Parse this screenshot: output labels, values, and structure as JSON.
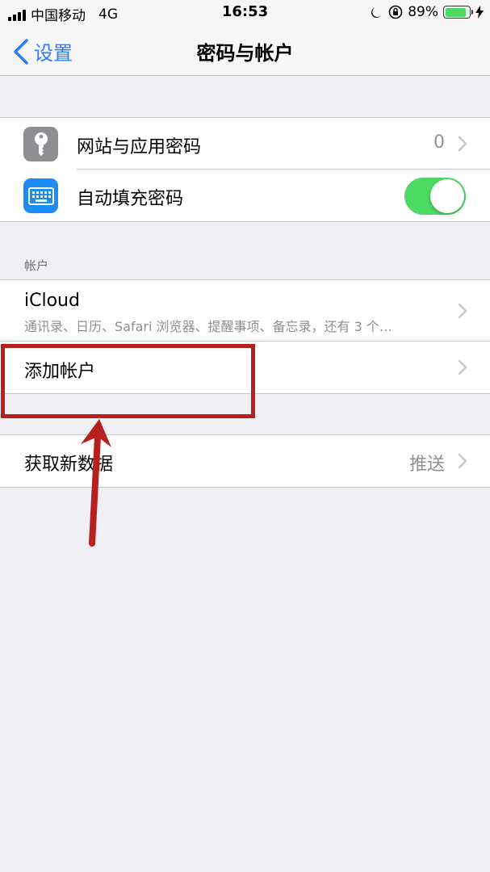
{
  "status_bar": {
    "carrier": "中国移动",
    "network": "4G",
    "time": "16:53",
    "battery_percent": "89%",
    "battery_level": 0.89
  },
  "nav": {
    "back_label": "设置",
    "title": "密码与帐户"
  },
  "passwords_group": {
    "website_passwords": {
      "label": "网站与应用密码",
      "value": "0"
    },
    "autofill": {
      "label": "自动填充密码",
      "enabled": true
    }
  },
  "accounts": {
    "header": "帐户",
    "icloud": {
      "title": "iCloud",
      "subtitle": "通讯录、日历、Safari 浏览器、提醒事项、备忘录，还有 3 个…"
    },
    "add_account": {
      "label": "添加帐户"
    }
  },
  "fetch": {
    "label": "获取新数据",
    "value": "推送"
  },
  "colors": {
    "accent": "#2f7cf6",
    "toggle_on": "#4cd964",
    "annotation": "#b8201f",
    "background": "#efeff4"
  },
  "icons": {
    "key": "key-icon",
    "keyboard": "keyboard-icon"
  }
}
